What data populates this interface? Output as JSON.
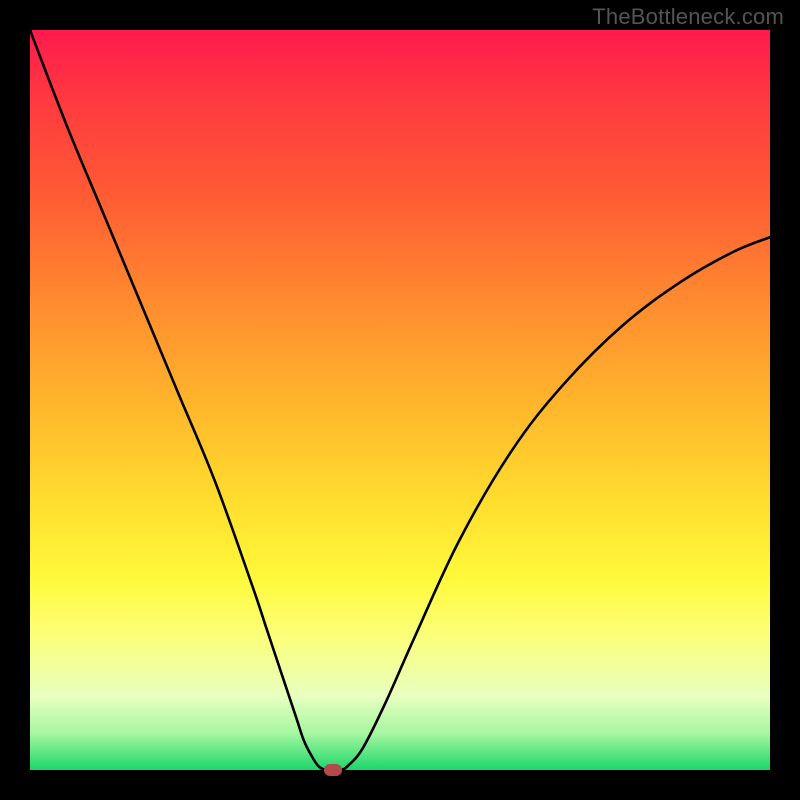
{
  "watermark": "TheBottleneck.com",
  "chart_data": {
    "type": "line",
    "title": "",
    "xlabel": "",
    "ylabel": "",
    "xlim": [
      0,
      100
    ],
    "ylim": [
      0,
      100
    ],
    "grid": false,
    "legend": false,
    "series": [
      {
        "name": "curve",
        "x": [
          0,
          5,
          10,
          15,
          20,
          25,
          30,
          32,
          34,
          36,
          37,
          38,
          39,
          40,
          41,
          42,
          43,
          45,
          48,
          52,
          58,
          65,
          72,
          80,
          88,
          95,
          100
        ],
        "y": [
          100,
          87,
          75,
          63,
          51,
          39,
          25,
          19,
          13,
          7,
          4,
          2,
          0.5,
          0,
          0,
          0,
          0.6,
          3,
          9,
          18,
          31,
          43,
          52,
          60,
          66,
          70,
          72
        ]
      }
    ],
    "marker": {
      "x": 41,
      "y": 0,
      "color": "#b54a4a"
    },
    "background_gradient_stops": [
      {
        "pos": 0,
        "color": "#ff1a4d"
      },
      {
        "pos": 10,
        "color": "#ff3b3f"
      },
      {
        "pos": 22,
        "color": "#ff5a34"
      },
      {
        "pos": 38,
        "color": "#ff8f2f"
      },
      {
        "pos": 50,
        "color": "#ffb42c"
      },
      {
        "pos": 63,
        "color": "#ffdb2e"
      },
      {
        "pos": 74,
        "color": "#fff93a"
      },
      {
        "pos": 82,
        "color": "#fbff7a"
      },
      {
        "pos": 90,
        "color": "#e8ffc0"
      },
      {
        "pos": 95,
        "color": "#a6f7a0"
      },
      {
        "pos": 100,
        "color": "#1cd66a"
      }
    ]
  }
}
